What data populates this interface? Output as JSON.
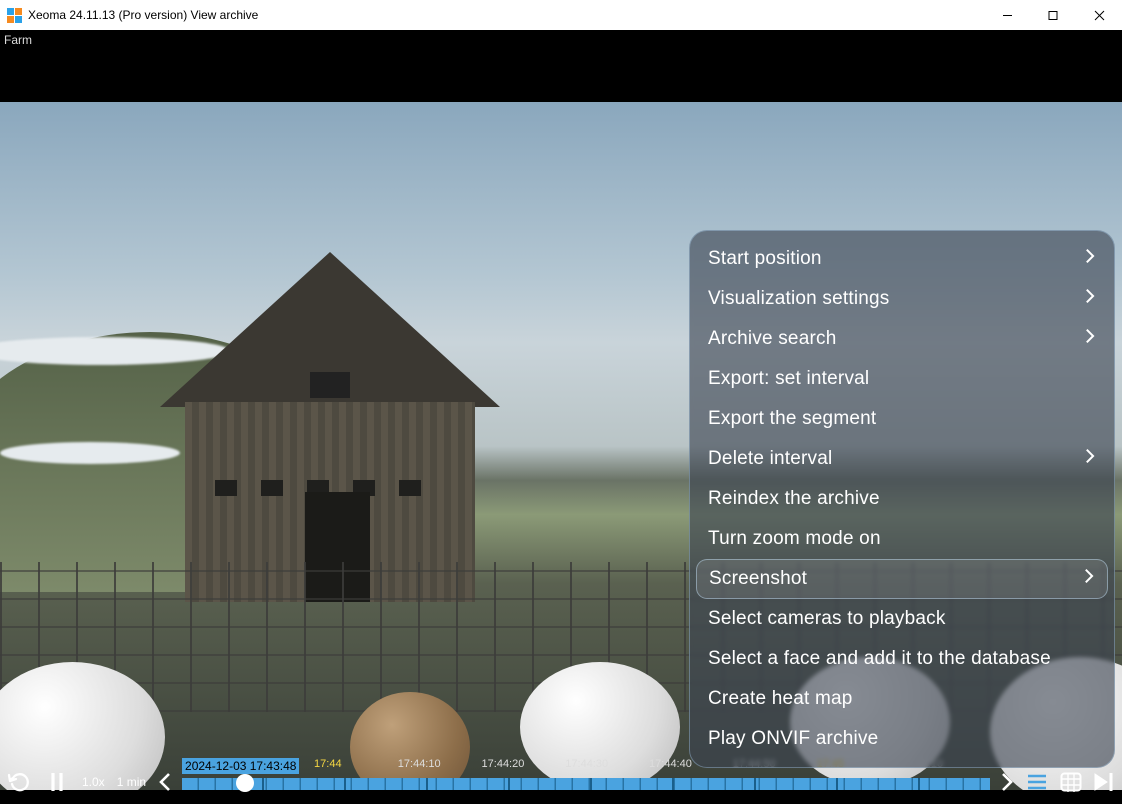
{
  "titlebar": {
    "title": "Xeoma 24.11.13 (Pro version) View archive"
  },
  "camera": {
    "name": "Farm"
  },
  "context_menu": {
    "items": [
      {
        "label": "Start position",
        "submenu": true,
        "active": false
      },
      {
        "label": "Visualization settings",
        "submenu": true,
        "active": false
      },
      {
        "label": "Archive search",
        "submenu": true,
        "active": false
      },
      {
        "label": "Export: set interval",
        "submenu": false,
        "active": false
      },
      {
        "label": "Export the segment",
        "submenu": false,
        "active": false
      },
      {
        "label": "Delete interval",
        "submenu": true,
        "active": false
      },
      {
        "label": "Reindex the archive",
        "submenu": false,
        "active": false
      },
      {
        "label": "Turn zoom mode on",
        "submenu": false,
        "active": false
      },
      {
        "label": "Screenshot",
        "submenu": true,
        "active": true
      },
      {
        "label": "Select cameras to playback",
        "submenu": false,
        "active": false
      },
      {
        "label": "Select a face and add it to the database",
        "submenu": false,
        "active": false
      },
      {
        "label": "Create heat map",
        "submenu": false,
        "active": false
      },
      {
        "label": "Play ONVIF archive",
        "submenu": false,
        "active": false
      }
    ]
  },
  "playback": {
    "speed": "1.0x",
    "scale": "1 min",
    "datetime": "2024-12-03 17:43:48",
    "ticks": [
      {
        "label": "17:44",
        "yellow": true
      },
      {
        "label": "17:44:10",
        "yellow": false
      },
      {
        "label": "17:44:20",
        "yellow": false
      },
      {
        "label": "17:44:30",
        "yellow": false
      },
      {
        "label": "17:44:40",
        "yellow": false
      },
      {
        "label": "17:44:50",
        "yellow": false
      },
      {
        "label": "17:45",
        "yellow": true
      },
      {
        "label": "17:45:10",
        "yellow": false
      }
    ]
  }
}
